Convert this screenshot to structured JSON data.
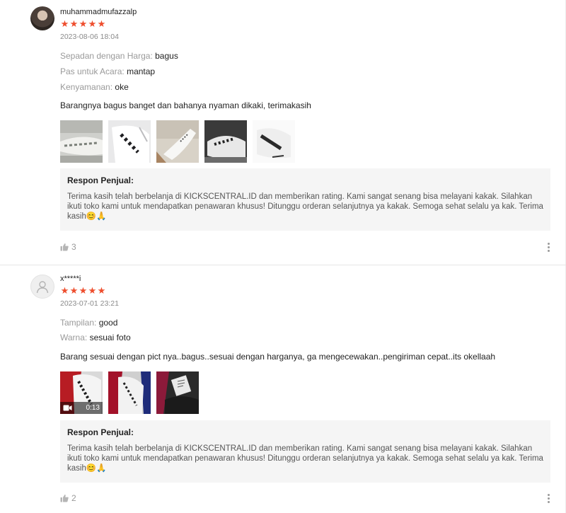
{
  "reviews": [
    {
      "username": "muhammadmufazzalp",
      "stars": [
        "★",
        "★",
        "★",
        "★",
        "★"
      ],
      "date": "2023-08-06 18:04",
      "attributes": [
        {
          "key": "Sepadan dengan Harga:",
          "value": "bagus"
        },
        {
          "key": "Pas untuk Acara:",
          "value": "mantap"
        },
        {
          "key": "Kenyamanan:",
          "value": "oke"
        }
      ],
      "comment": "Barangnya bagus banget dan bahanya nyaman dikaki, terimakasih",
      "reply_title": "Respon Penjual:",
      "reply_text": "Terima kasih telah berbelanja di KICKSCENTRAL.ID dan memberikan rating. Kami sangat senang bisa melayani kakak. Silahkan ikuti toko kami untuk mendapatkan penawaran khusus! Ditunggu orderan selanjutnya ya kakak. Semoga sehat selalu ya kak. Terima kasih😊🙏",
      "likes": "3"
    },
    {
      "username": "x*****i",
      "stars": [
        "★",
        "★",
        "★",
        "★",
        "★"
      ],
      "date": "2023-07-01 23:21",
      "attributes": [
        {
          "key": "Tampilan:",
          "value": "good"
        },
        {
          "key": "Warna:",
          "value": "sesuai foto"
        }
      ],
      "comment": "Barang sesuai dengan pict nya..bagus..sesuai dengan harganya, ga mengecewakan..pengiriman cepat..its okellaah",
      "video_duration": "0:13",
      "reply_title": "Respon Penjual:",
      "reply_text": "Terima kasih telah berbelanja di KICKSCENTRAL.ID dan memberikan rating. Kami sangat senang bisa melayani kakak. Silahkan ikuti toko kami untuk mendapatkan penawaran khusus! Ditunggu orderan selanjutnya ya kakak. Semoga sehat selalu ya kak. Terima kasih😊🙏",
      "likes": "2"
    }
  ],
  "colors": {
    "star": "#ee4d2d",
    "muted": "#9a9a9a",
    "reply_bg": "#f5f5f5"
  }
}
